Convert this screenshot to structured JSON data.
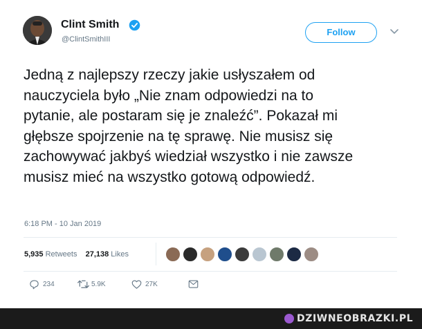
{
  "tweet": {
    "author_name": "Clint Smith",
    "author_handle": "@ClintSmithIII",
    "follow_label": "Follow",
    "text": "Jedną z najlepszy rzeczy jakie usłyszałem od\nnauczyciela było „Nie znam odpowiedzi na to\npytanie, ale postaram się je znaleźć”. Pokazał mi\ngłębsze spojrzenie na tę sprawę. Nie musisz się\nzachowywać jakbyś wiedział wszystko i nie zawsze\nmusisz mieć na wszystko gotową odpowiedź.",
    "timestamp": "6:18 PM - 10 Jan 2019",
    "retweets_count": "5,935",
    "retweets_label": "Retweets",
    "likes_count": "27,138",
    "likes_label": "Likes",
    "actions": {
      "reply_count": "234",
      "retweet_count": "5.9K",
      "like_count": "27K"
    }
  },
  "watermark": {
    "text": "DZIWNEOBRAZKI.PL"
  },
  "icons": [
    "verified-badge-icon",
    "chevron-down-icon",
    "reply-icon",
    "retweet-icon",
    "like-heart-icon",
    "direct-message-icon"
  ],
  "colors": {
    "accent": "#1da1f2",
    "text": "#14171a",
    "muted": "#657786",
    "footer": "#1b1b1b"
  }
}
